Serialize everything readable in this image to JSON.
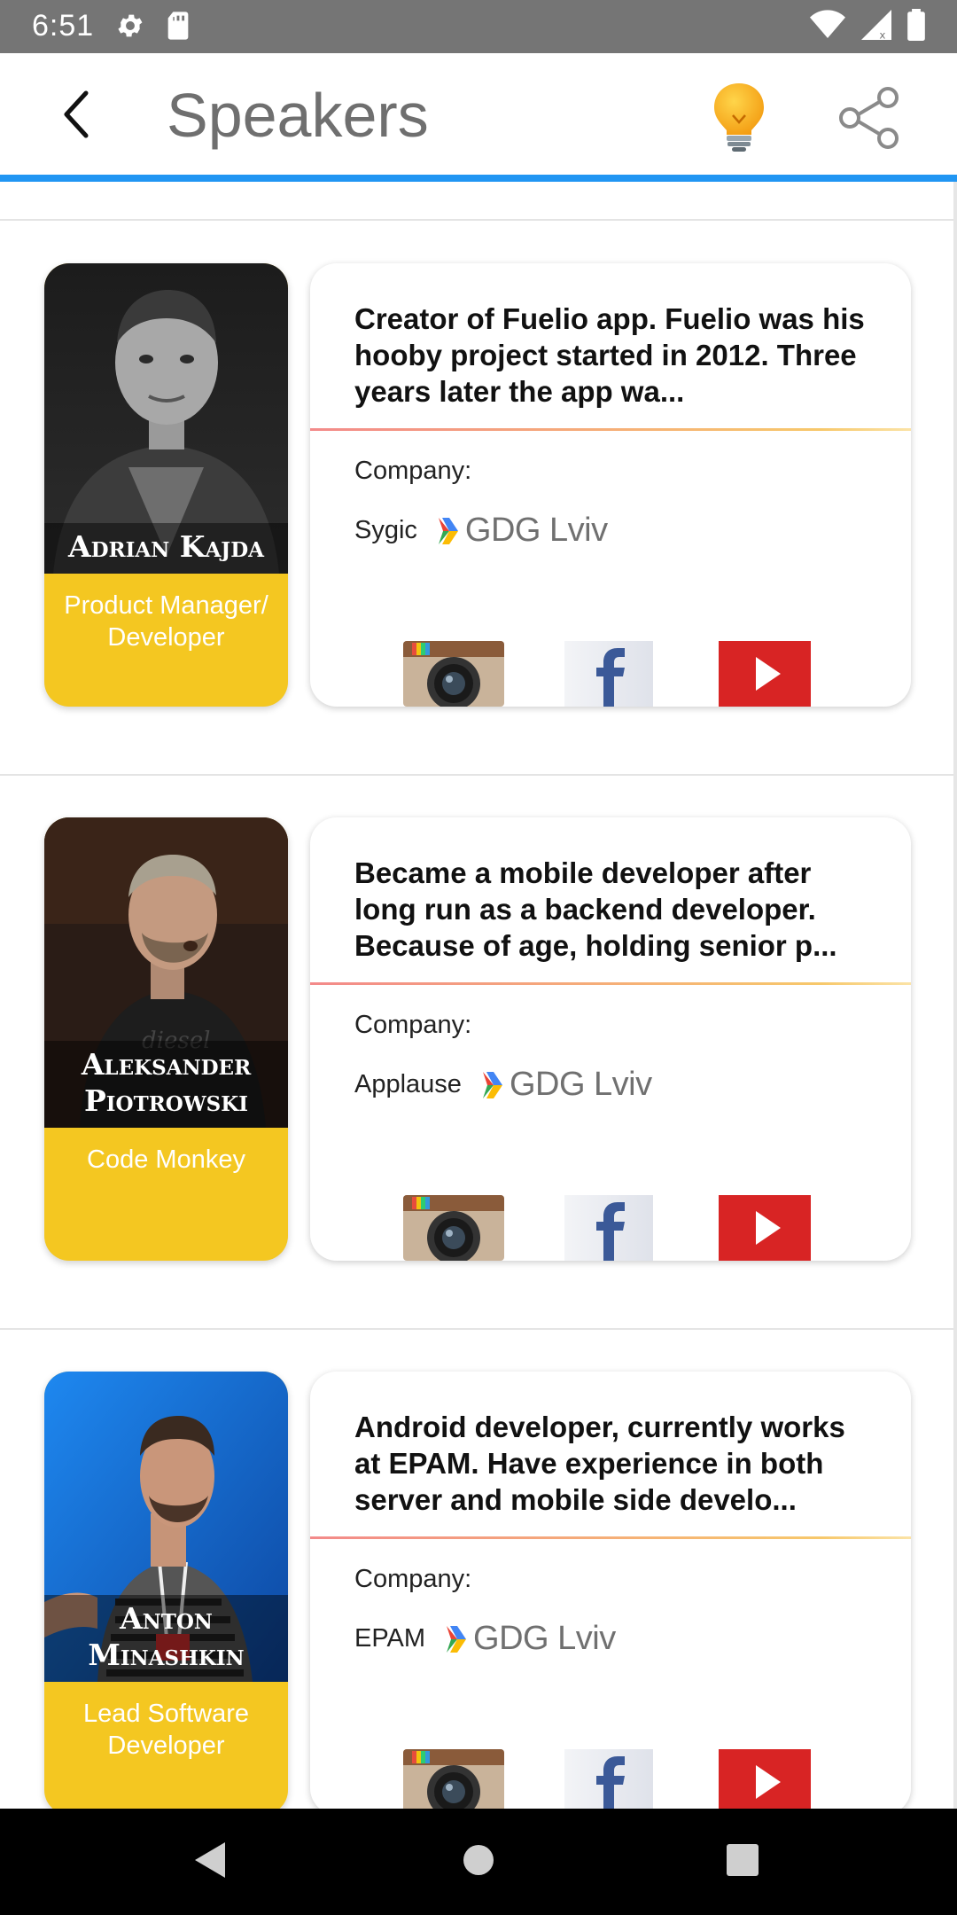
{
  "status_bar": {
    "time": "6:51"
  },
  "app_bar": {
    "title": "Speakers"
  },
  "speakers": [
    {
      "name_line1": "Adrian Kajda",
      "name_line2": "",
      "role": "Product Manager/ Developer",
      "bio": "Creator of Fuelio app. Fuelio was his hooby project started in 2012. Three years later the app wa...",
      "company_label": "Company:",
      "company": "Sygic",
      "community": "GDG Lviv"
    },
    {
      "name_line1": "Aleksander",
      "name_line2": "Piotrowski",
      "role": "Code Monkey",
      "bio": "Became a mobile developer after long run as a backend developer. Because of age, holding senior p...",
      "company_label": "Company:",
      "company": "Applause",
      "community": "GDG Lviv"
    },
    {
      "name_line1": "Anton",
      "name_line2": "Minashkin",
      "role": "Lead Software Developer",
      "bio": "Android developer, currently works at EPAM. Have experience in both server and mobile side develo...",
      "company_label": "Company:",
      "company": "EPAM",
      "community": "GDG Lviv"
    }
  ],
  "icons": {
    "back": "arrow-left-icon",
    "idea": "lightbulb-icon",
    "share": "share-icon",
    "instagram": "instagram-icon",
    "facebook": "facebook-icon",
    "youtube": "youtube-icon"
  },
  "colors": {
    "accent_blue": "#2196f3",
    "role_yellow": "#f4c721",
    "youtube_red": "#d82424"
  }
}
